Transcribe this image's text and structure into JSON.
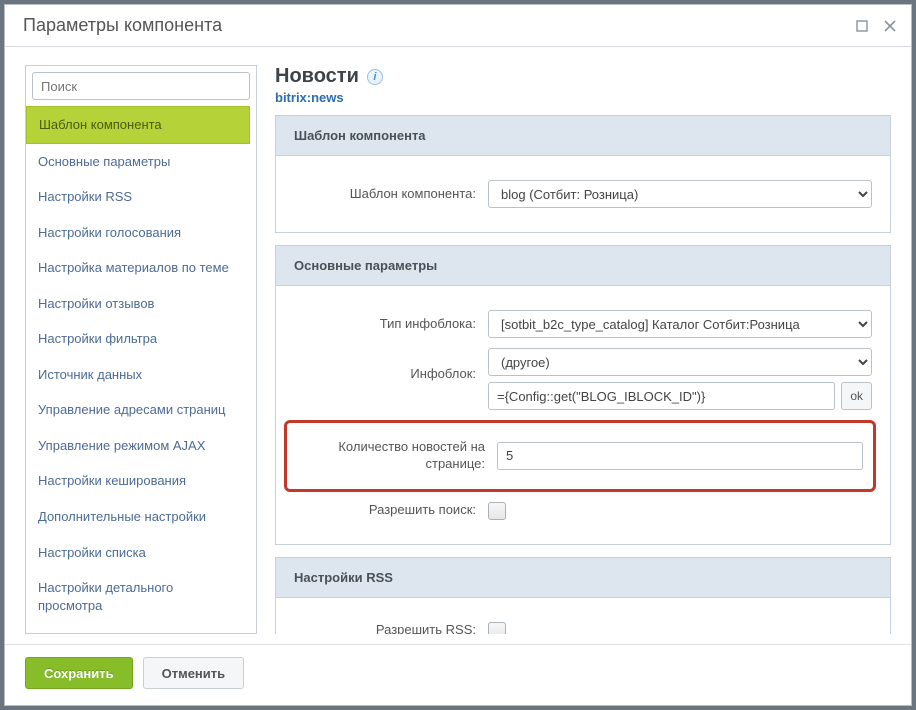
{
  "title": "Параметры компонента",
  "search_placeholder": "Поиск",
  "nav": {
    "items": [
      "Шаблон компонента",
      "Основные параметры",
      "Настройки RSS",
      "Настройки голосования",
      "Настройка материалов по теме",
      "Настройки отзывов",
      "Настройки фильтра",
      "Источник данных",
      "Управление адресами страниц",
      "Управление режимом AJAX",
      "Настройки кеширования",
      "Дополнительные настройки",
      "Настройки списка",
      "Настройки детального просмотра"
    ],
    "active_index": 0
  },
  "main": {
    "title": "Новости",
    "code": "bitrix:news"
  },
  "sections": {
    "template": {
      "heading": "Шаблон компонента",
      "field_label": "Шаблон компонента:",
      "field_value": "blog (Сотбит: Розница)"
    },
    "basic": {
      "heading": "Основные параметры",
      "iblock_type_label": "Тип инфоблока:",
      "iblock_type_value": "[sotbit_b2c_type_catalog] Каталог Сотбит:Розница",
      "iblock_label": "Инфоблок:",
      "iblock_select": "(другое)",
      "iblock_input": "={Config::get(\"BLOG_IBLOCK_ID\")}",
      "ok_label": "ok",
      "count_label": "Количество новостей на странице:",
      "count_value": "5",
      "allow_search_label": "Разрешить поиск:"
    },
    "rss": {
      "heading": "Настройки RSS",
      "allow_rss_label": "Разрешить RSS:"
    }
  },
  "footer": {
    "save": "Сохранить",
    "cancel": "Отменить"
  }
}
